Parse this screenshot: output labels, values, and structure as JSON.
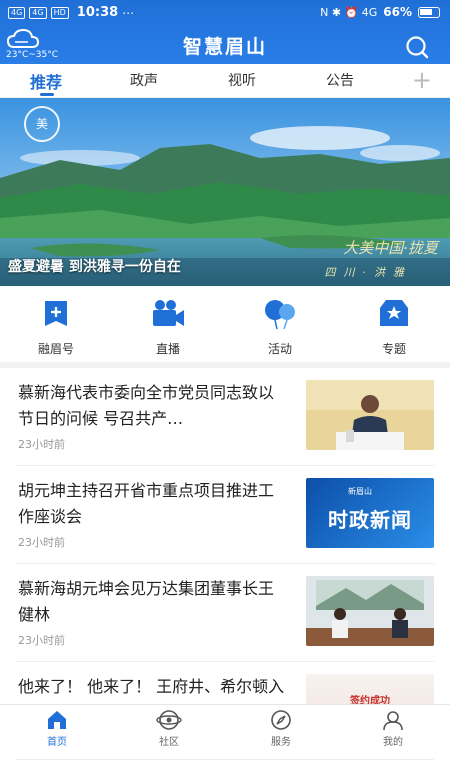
{
  "status_bar": {
    "signal_1": "4G",
    "signal_2": "4G",
    "hd": "HD",
    "time": "10:38",
    "extra": "⋯",
    "right_icons": "N ✱ ⏰ 4G",
    "battery": "66%"
  },
  "header": {
    "weather_temp": "23°C~35°C",
    "title": "智慧眉山",
    "accent": "#1f6fd6"
  },
  "tabs": [
    {
      "label": "推荐",
      "active": true
    },
    {
      "label": "政声"
    },
    {
      "label": "视听"
    },
    {
      "label": "公告"
    }
  ],
  "tab_add": "+",
  "banner": {
    "caption": "盛夏避暑 到洪雅寻一份自在",
    "logo_text": "美",
    "calligraphy": "大美中国·拢夏",
    "calligraphy_sub": "四川·洪雅"
  },
  "shortcuts": [
    {
      "label": "融眉号",
      "icon": "add-doc-icon"
    },
    {
      "label": "直播",
      "icon": "video-camera-icon"
    },
    {
      "label": "活动",
      "icon": "balloon-icon"
    },
    {
      "label": "专题",
      "icon": "badge-icon"
    }
  ],
  "news": [
    {
      "title": "慕新海代表市委向全市党员同志致以节日的问候  号召共产…",
      "time": "23小时前",
      "thumb": "meeting-speech"
    },
    {
      "title": "胡元坤主持召开省市重点项目推进工作座谈会",
      "time": "23小时前",
      "thumb": "news-card",
      "thumb_text": "时政新闻",
      "thumb_small": "新眉山"
    },
    {
      "title": "慕新海胡元坤会见万达集团董事长王健林",
      "time": "23小时前",
      "thumb": "meeting-room"
    },
    {
      "title": "他来了！ 他来了！ 王府井、希尔顿入驻雕像国际广场啦！",
      "time": "",
      "thumb": "promo",
      "thumb_text": "签约成功"
    }
  ],
  "tabbar": [
    {
      "label": "首页",
      "icon": "home-icon",
      "active": true
    },
    {
      "label": "社区",
      "icon": "community-icon"
    },
    {
      "label": "服务",
      "icon": "compass-icon"
    },
    {
      "label": "我的",
      "icon": "user-icon"
    }
  ]
}
